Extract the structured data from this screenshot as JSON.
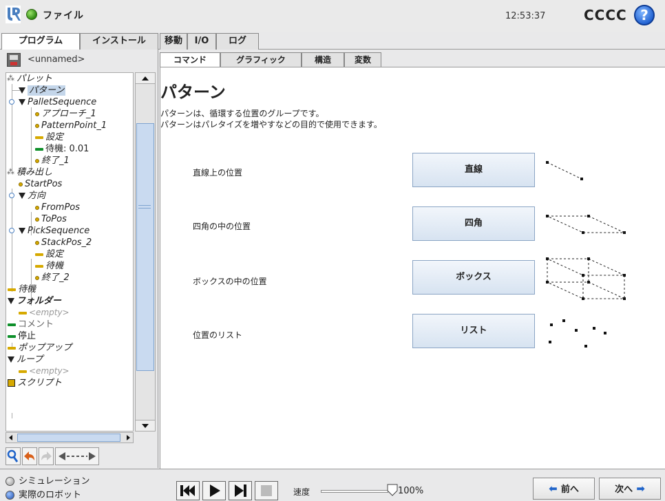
{
  "topbar": {
    "file_menu": "ファイル",
    "clock": "12:53:37",
    "robot_name": "CCCC",
    "help": "?"
  },
  "main_tabs": [
    "プログラム",
    "インストール",
    "移動",
    "I/O",
    "ログ"
  ],
  "program": {
    "name": "<unnamed>"
  },
  "tree": [
    "パレット",
    "パターン",
    "PalletSequence",
    "アプローチ_1",
    "PatternPoint_1",
    "設定",
    "待機: 0.01",
    "終了_1",
    "積み出し",
    "StartPos",
    "方向",
    "FromPos",
    "ToPos",
    "PickSequence",
    "StackPos_2",
    "設定",
    "待機",
    "終了_2",
    "待機",
    "フォルダー",
    "<empty>",
    "コメント",
    "停止",
    "ポップアップ",
    "ループ",
    "<empty>",
    "スクリプト"
  ],
  "sub_tabs": [
    "コマンド",
    "グラフィック",
    "構造",
    "変数"
  ],
  "content": {
    "title": "パターン",
    "desc1": "パターンは、循環する位置のグループです。",
    "desc2": "パターンはパレタイズを増やすなどの目的で使用できます。",
    "rows": [
      {
        "label": "直線上の位置",
        "button": "直線",
        "icon": "line-pattern-icon"
      },
      {
        "label": "四角の中の位置",
        "button": "四角",
        "icon": "square-pattern-icon"
      },
      {
        "label": "ボックスの中の位置",
        "button": "ボックス",
        "icon": "box-pattern-icon"
      },
      {
        "label": "位置のリスト",
        "button": "リスト",
        "icon": "list-pattern-icon"
      }
    ]
  },
  "bottom": {
    "simulation": "シミュレーション",
    "real_robot": "実際のロボット",
    "speed_label": "速度",
    "speed_value": "100%",
    "speed_fraction": 1.0,
    "prev": "前へ",
    "next": "次へ"
  },
  "colors": {
    "accent_blue": "#1f63c9",
    "button_bg": "#d7e3f1",
    "tree_selected": "#c4d6ea",
    "status_green": "#2f8a12"
  }
}
